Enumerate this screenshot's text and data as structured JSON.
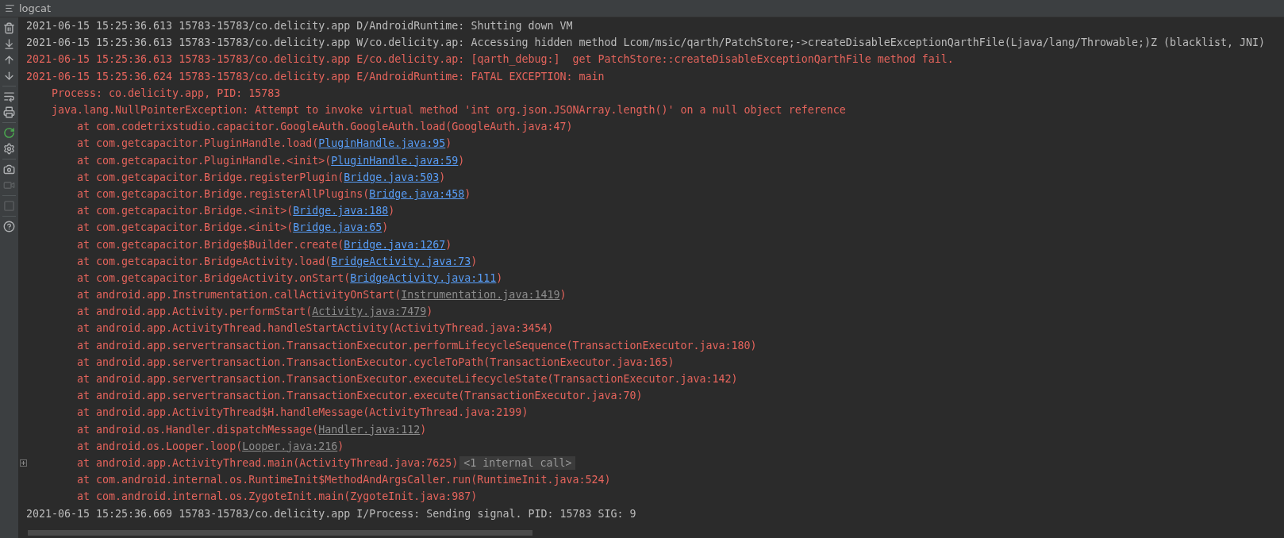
{
  "panel": {
    "title": "logcat"
  },
  "toolbar": [
    {
      "kind": "trash",
      "disabled": false
    },
    {
      "kind": "scroll-end",
      "disabled": false
    },
    {
      "kind": "up",
      "disabled": false
    },
    {
      "kind": "down",
      "disabled": false
    },
    {
      "kind": "sep"
    },
    {
      "kind": "wrap",
      "disabled": false
    },
    {
      "kind": "print",
      "disabled": false
    },
    {
      "kind": "sep"
    },
    {
      "kind": "restart",
      "disabled": false
    },
    {
      "kind": "settings",
      "disabled": false
    },
    {
      "kind": "sep"
    },
    {
      "kind": "camera",
      "disabled": false
    },
    {
      "kind": "video",
      "disabled": true
    },
    {
      "kind": "sep"
    },
    {
      "kind": "stop",
      "disabled": true
    },
    {
      "kind": "sep"
    },
    {
      "kind": "help",
      "disabled": false
    }
  ],
  "log": [
    {
      "kind": "entry",
      "error": false,
      "fold_marker": false,
      "parts": [
        {
          "kind": "plain",
          "text": "2021-06-15 15:25:36.613 15783-15783/co.delicity.app D/AndroidRuntime: Shutting down VM"
        }
      ]
    },
    {
      "kind": "entry",
      "error": false,
      "fold_marker": false,
      "parts": [
        {
          "kind": "plain",
          "text": "2021-06-15 15:25:36.613 15783-15783/co.delicity.app W/co.delicity.ap: Accessing hidden method Lcom/msic/qarth/PatchStore;->createDisableExceptionQarthFile(Ljava/lang/Throwable;)Z (blacklist, JNI)"
        }
      ]
    },
    {
      "kind": "entry",
      "error": true,
      "fold_marker": false,
      "parts": [
        {
          "kind": "plain",
          "text": "2021-06-15 15:25:36.613 15783-15783/co.delicity.app E/co.delicity.ap: [qarth_debug:]  get PatchStore::createDisableExceptionQarthFile method fail."
        }
      ]
    },
    {
      "kind": "entry",
      "error": true,
      "fold_marker": false,
      "parts": [
        {
          "kind": "plain",
          "text": "2021-06-15 15:25:36.624 15783-15783/co.delicity.app E/AndroidRuntime: FATAL EXCEPTION: main"
        }
      ]
    },
    {
      "kind": "detail",
      "error": true,
      "fold_marker": false,
      "parts": [
        {
          "kind": "plain",
          "text": "Process: co.delicity.app, PID: 15783"
        }
      ]
    },
    {
      "kind": "detail",
      "error": true,
      "fold_marker": false,
      "parts": [
        {
          "kind": "plain",
          "text": "java.lang.NullPointerException: Attempt to invoke virtual method 'int org.json.JSONArray.length()' on a null object reference"
        }
      ]
    },
    {
      "kind": "frame",
      "error": true,
      "fold_marker": false,
      "parts": [
        {
          "kind": "plain",
          "text": "at com.codetrixstudio.capacitor.GoogleAuth.GoogleAuth.load(GoogleAuth.java:47)"
        }
      ]
    },
    {
      "kind": "frame",
      "error": true,
      "fold_marker": false,
      "parts": [
        {
          "kind": "plain",
          "text": "at com.getcapacitor.PluginHandle.load("
        },
        {
          "kind": "link",
          "text": "PluginHandle.java:95"
        },
        {
          "kind": "plain",
          "text": ")"
        }
      ]
    },
    {
      "kind": "frame",
      "error": true,
      "fold_marker": false,
      "parts": [
        {
          "kind": "plain",
          "text": "at com.getcapacitor.PluginHandle.<init>("
        },
        {
          "kind": "link",
          "text": "PluginHandle.java:59"
        },
        {
          "kind": "plain",
          "text": ")"
        }
      ]
    },
    {
      "kind": "frame",
      "error": true,
      "fold_marker": false,
      "parts": [
        {
          "kind": "plain",
          "text": "at com.getcapacitor.Bridge.registerPlugin("
        },
        {
          "kind": "link",
          "text": "Bridge.java:503"
        },
        {
          "kind": "plain",
          "text": ")"
        }
      ]
    },
    {
      "kind": "frame",
      "error": true,
      "fold_marker": false,
      "parts": [
        {
          "kind": "plain",
          "text": "at com.getcapacitor.Bridge.registerAllPlugins("
        },
        {
          "kind": "link",
          "text": "Bridge.java:458"
        },
        {
          "kind": "plain",
          "text": ")"
        }
      ]
    },
    {
      "kind": "frame",
      "error": true,
      "fold_marker": false,
      "parts": [
        {
          "kind": "plain",
          "text": "at com.getcapacitor.Bridge.<init>("
        },
        {
          "kind": "link",
          "text": "Bridge.java:188"
        },
        {
          "kind": "plain",
          "text": ")"
        }
      ]
    },
    {
      "kind": "frame",
      "error": true,
      "fold_marker": false,
      "parts": [
        {
          "kind": "plain",
          "text": "at com.getcapacitor.Bridge.<init>("
        },
        {
          "kind": "link",
          "text": "Bridge.java:65"
        },
        {
          "kind": "plain",
          "text": ")"
        }
      ]
    },
    {
      "kind": "frame",
      "error": true,
      "fold_marker": false,
      "parts": [
        {
          "kind": "plain",
          "text": "at com.getcapacitor.Bridge$Builder.create("
        },
        {
          "kind": "link",
          "text": "Bridge.java:1267"
        },
        {
          "kind": "plain",
          "text": ")"
        }
      ]
    },
    {
      "kind": "frame",
      "error": true,
      "fold_marker": false,
      "parts": [
        {
          "kind": "plain",
          "text": "at com.getcapacitor.BridgeActivity.load("
        },
        {
          "kind": "link",
          "text": "BridgeActivity.java:73"
        },
        {
          "kind": "plain",
          "text": ")"
        }
      ]
    },
    {
      "kind": "frame",
      "error": true,
      "fold_marker": false,
      "parts": [
        {
          "kind": "plain",
          "text": "at com.getcapacitor.BridgeActivity.onStart("
        },
        {
          "kind": "link",
          "text": "BridgeActivity.java:111"
        },
        {
          "kind": "plain",
          "text": ")"
        }
      ]
    },
    {
      "kind": "frame",
      "error": true,
      "fold_marker": false,
      "parts": [
        {
          "kind": "plain",
          "text": "at android.app.Instrumentation.callActivityOnStart("
        },
        {
          "kind": "lib-link",
          "text": "Instrumentation.java:1419"
        },
        {
          "kind": "plain",
          "text": ")"
        }
      ]
    },
    {
      "kind": "frame",
      "error": true,
      "fold_marker": false,
      "parts": [
        {
          "kind": "plain",
          "text": "at android.app.Activity.performStart("
        },
        {
          "kind": "lib-link",
          "text": "Activity.java:7479"
        },
        {
          "kind": "plain",
          "text": ")"
        }
      ]
    },
    {
      "kind": "frame",
      "error": true,
      "fold_marker": false,
      "parts": [
        {
          "kind": "plain",
          "text": "at android.app.ActivityThread.handleStartActivity(ActivityThread.java:3454)"
        }
      ]
    },
    {
      "kind": "frame",
      "error": true,
      "fold_marker": false,
      "parts": [
        {
          "kind": "plain",
          "text": "at android.app.servertransaction.TransactionExecutor.performLifecycleSequence(TransactionExecutor.java:180)"
        }
      ]
    },
    {
      "kind": "frame",
      "error": true,
      "fold_marker": false,
      "parts": [
        {
          "kind": "plain",
          "text": "at android.app.servertransaction.TransactionExecutor.cycleToPath(TransactionExecutor.java:165)"
        }
      ]
    },
    {
      "kind": "frame",
      "error": true,
      "fold_marker": false,
      "parts": [
        {
          "kind": "plain",
          "text": "at android.app.servertransaction.TransactionExecutor.executeLifecycleState(TransactionExecutor.java:142)"
        }
      ]
    },
    {
      "kind": "frame",
      "error": true,
      "fold_marker": false,
      "parts": [
        {
          "kind": "plain",
          "text": "at android.app.servertransaction.TransactionExecutor.execute(TransactionExecutor.java:70)"
        }
      ]
    },
    {
      "kind": "frame",
      "error": true,
      "fold_marker": false,
      "parts": [
        {
          "kind": "plain",
          "text": "at android.app.ActivityThread$H.handleMessage(ActivityThread.java:2199)"
        }
      ]
    },
    {
      "kind": "frame",
      "error": true,
      "fold_marker": false,
      "parts": [
        {
          "kind": "plain",
          "text": "at android.os.Handler.dispatchMessage("
        },
        {
          "kind": "lib-link",
          "text": "Handler.java:112"
        },
        {
          "kind": "plain",
          "text": ")"
        }
      ]
    },
    {
      "kind": "frame",
      "error": true,
      "fold_marker": false,
      "parts": [
        {
          "kind": "plain",
          "text": "at android.os.Looper.loop("
        },
        {
          "kind": "lib-link",
          "text": "Looper.java:216"
        },
        {
          "kind": "plain",
          "text": ")"
        }
      ]
    },
    {
      "kind": "frame",
      "error": true,
      "fold_marker": true,
      "parts": [
        {
          "kind": "plain",
          "text": "at android.app.ActivityThread.main(ActivityThread.java:7625)"
        },
        {
          "kind": "fold",
          "text": "<1 internal call>"
        }
      ]
    },
    {
      "kind": "frame",
      "error": true,
      "fold_marker": false,
      "parts": [
        {
          "kind": "plain",
          "text": "at com.android.internal.os.RuntimeInit$MethodAndArgsCaller.run(RuntimeInit.java:524)"
        }
      ]
    },
    {
      "kind": "frame",
      "error": true,
      "fold_marker": false,
      "parts": [
        {
          "kind": "plain",
          "text": "at com.android.internal.os.ZygoteInit.main(ZygoteInit.java:987)"
        }
      ]
    },
    {
      "kind": "entry",
      "error": false,
      "fold_marker": false,
      "parts": [
        {
          "kind": "plain",
          "text": "2021-06-15 15:25:36.669 15783-15783/co.delicity.app I/Process: Sending signal. PID: 15783 SIG: 9"
        }
      ]
    }
  ]
}
